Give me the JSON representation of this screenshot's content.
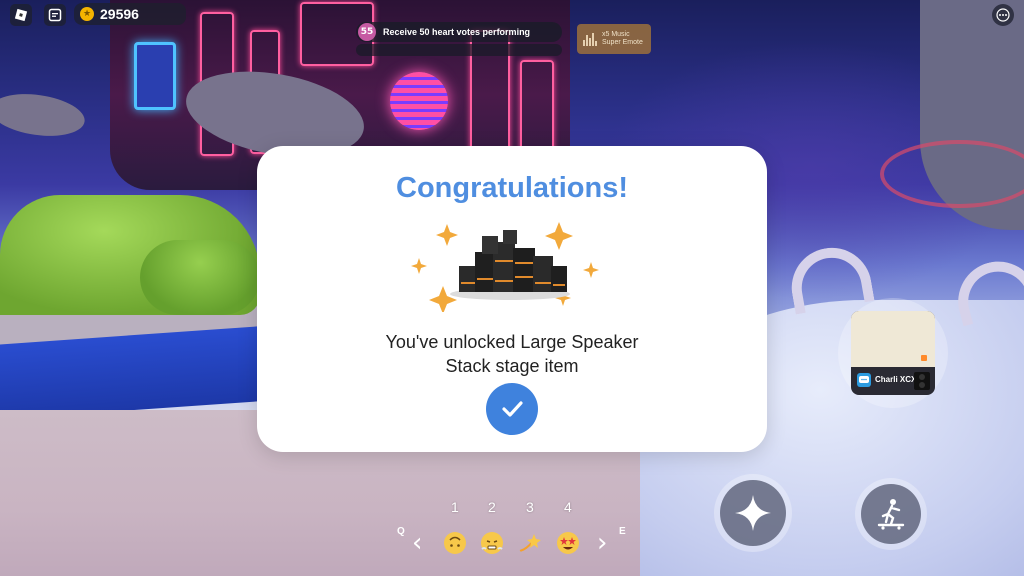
{
  "hud": {
    "roblox_icon": "roblox-logo-icon",
    "chat_icon": "chat-icon",
    "coins": "29596",
    "coin_icon": "star-coin-icon",
    "menu_icon": "more-icon"
  },
  "quest": {
    "count": "55",
    "text": "Receive 50 heart votes performing"
  },
  "reward": {
    "line1": "x5 Music",
    "line2": "Super Emote",
    "icon": "music-bars-icon"
  },
  "modal": {
    "title": "Congratulations!",
    "message_line1": "You've unlocked Large Speaker",
    "message_line2": "Stack stage item",
    "confirm_icon": "checkmark-icon",
    "item_icon": "speaker-stack-icon"
  },
  "emote_bar": {
    "left_key": "Q",
    "right_key": "E",
    "slots": [
      {
        "number": "1",
        "emoji": "face-upside-down-icon"
      },
      {
        "number": "2",
        "emoji": "face-steam-icon"
      },
      {
        "number": "3",
        "emoji": "dizzy-icon"
      },
      {
        "number": "4",
        "emoji": "star-struck-icon"
      }
    ]
  },
  "npc": {
    "name": "Charli XCX",
    "chat_icon": "chat-bubble-icon"
  },
  "actions": {
    "sparkle_icon": "sparkle-icon",
    "skate_icon": "skateboard-icon"
  },
  "colors": {
    "title_blue": "#4f8ee0",
    "confirm_blue": "#3f82dd",
    "coin_gold": "#f4b400",
    "sparkle_orange": "#f2a93b"
  }
}
